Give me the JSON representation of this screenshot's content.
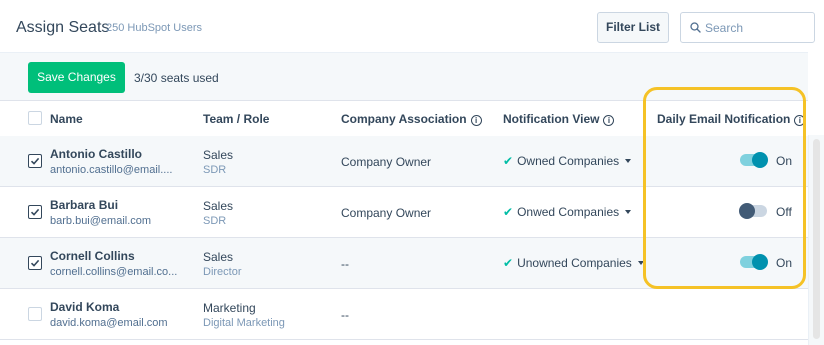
{
  "header": {
    "title": "Assign Seats",
    "subtitle": "250 HubSpot Users",
    "filter_label": "Filter List",
    "search_placeholder": "Search"
  },
  "toolbar": {
    "save_label": "Save Changes",
    "seats_text": "3/30 seats used"
  },
  "columns": [
    "Name",
    "Team / Role",
    "Company Association",
    "Notification View",
    "Daily Email Notification"
  ],
  "rows": [
    {
      "checked": true,
      "name": "Antonio Castillo",
      "email": "antonio.castillo@email....",
      "team": "Sales",
      "role": "SDR",
      "association": "Company Owner",
      "notification_view": "Owned Companies",
      "daily_email": "On"
    },
    {
      "checked": true,
      "name": "Barbara Bui",
      "email": "barb.bui@email.com",
      "team": "Sales",
      "role": "SDR",
      "association": "Company Owner",
      "notification_view": "Onwed Companies",
      "daily_email": "Off"
    },
    {
      "checked": true,
      "name": "Cornell Collins",
      "email": "cornell.collins@email.co...",
      "team": "Sales",
      "role": "Director",
      "association": "--",
      "notification_view": "Unowned Companies",
      "daily_email": "On"
    },
    {
      "checked": false,
      "name": "David Koma",
      "email": "david.koma@email.com",
      "team": "Marketing",
      "role": "Digital Marketing",
      "association": "--",
      "notification_view": "",
      "daily_email": ""
    }
  ],
  "colors": {
    "save_button": "#00bf7a",
    "toggle_on_knob": "#0091ae",
    "toggle_off_knob": "#425b76",
    "check_mark": "#00bda5",
    "highlight": "#f5c226"
  }
}
